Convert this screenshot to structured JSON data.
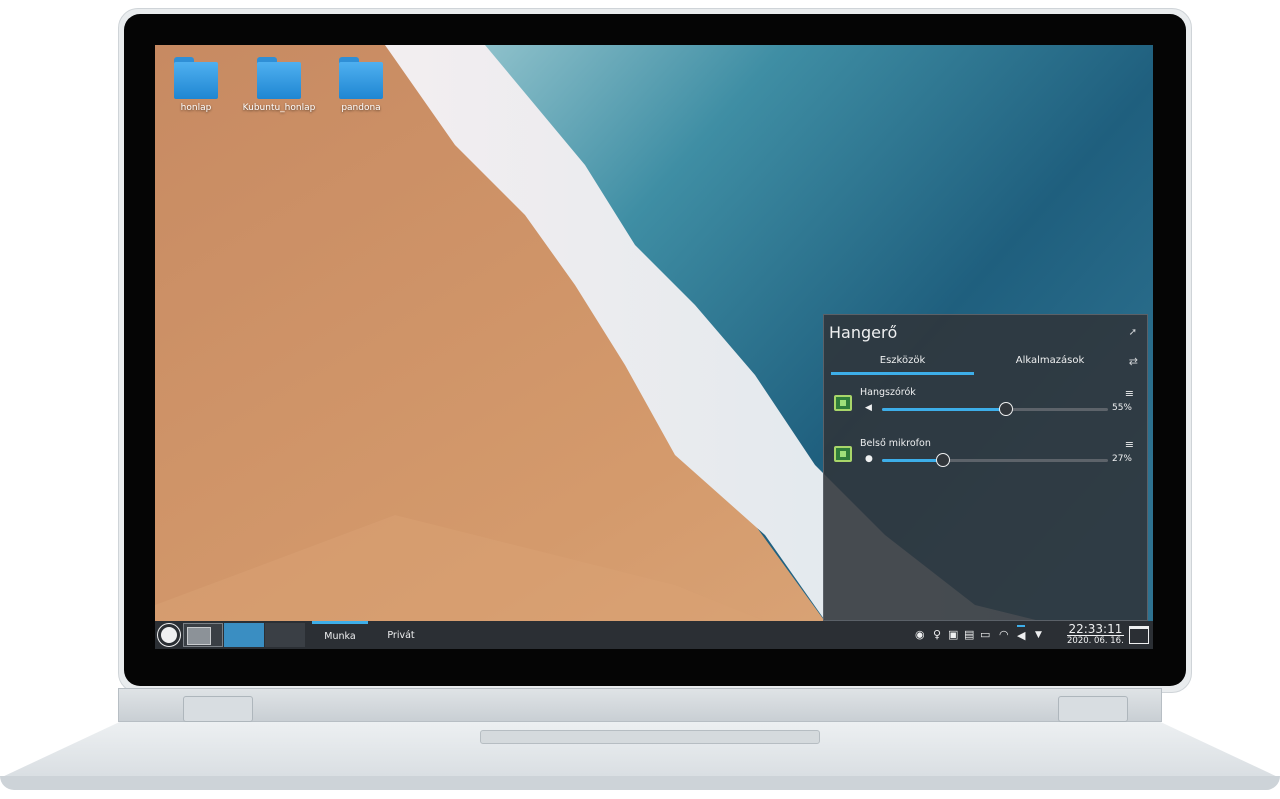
{
  "desktop": {
    "icons": [
      {
        "label": "honlap"
      },
      {
        "label": "Kubuntu_honlap"
      },
      {
        "label": "pandona"
      }
    ]
  },
  "volume_popup": {
    "title": "Hangerő",
    "pin_icon": "pin-icon",
    "tabs": [
      {
        "label": "Eszközök",
        "active": true
      },
      {
        "label": "Alkalmazások",
        "active": false
      }
    ],
    "configure_icon": "configure-icon",
    "devices": [
      {
        "name": "Hangszórók",
        "volume_text": "55%",
        "volume": 0.55,
        "icon": "sound-card-icon",
        "level_icon": "speaker-icon"
      },
      {
        "name": "Belső mikrofon",
        "volume_text": "27%",
        "volume": 0.27,
        "icon": "sound-card-icon",
        "level_icon": "microphone-icon"
      }
    ]
  },
  "panel": {
    "launcher_icon": "application-launcher-icon",
    "activities": [
      {
        "label": "Munka",
        "active": true
      },
      {
        "label": "Privát",
        "active": false
      }
    ],
    "tray_icons": [
      "user-icon",
      "bulb-icon",
      "clipboard-icon",
      "notes-icon",
      "battery-icon",
      "wifi-icon",
      "volume-icon",
      "expand-tray-icon"
    ],
    "clock": {
      "time": "22:33:11",
      "date": "2020. 06. 16."
    }
  },
  "colors": {
    "accent": "#3daee9",
    "panel": "#2b2f34",
    "popup_bg": "#30343a"
  }
}
